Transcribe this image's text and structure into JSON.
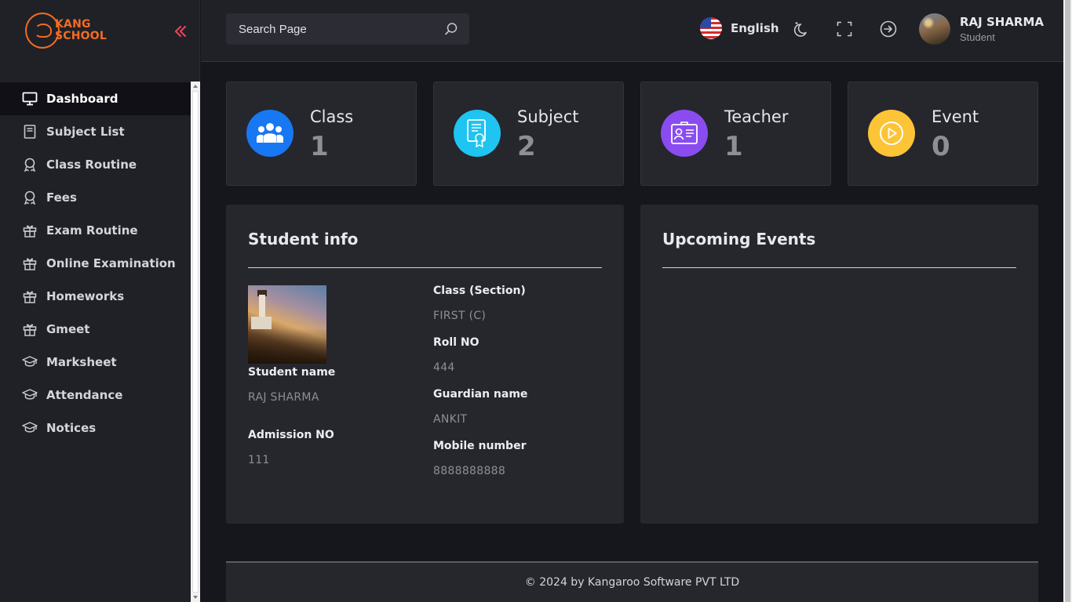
{
  "brand": {
    "line1": "KANG",
    "line2": "SCHOOL",
    "accent": "#f26d21"
  },
  "sidebar": {
    "items": [
      {
        "label": "Dashboard",
        "icon": "monitor-icon",
        "active": true
      },
      {
        "label": "Subject List",
        "icon": "book-icon"
      },
      {
        "label": "Class Routine",
        "icon": "award-icon"
      },
      {
        "label": "Fees",
        "icon": "award-icon"
      },
      {
        "label": "Exam Routine",
        "icon": "gift-icon"
      },
      {
        "label": "Online Examination",
        "icon": "gift-icon"
      },
      {
        "label": "Homeworks",
        "icon": "gift-icon"
      },
      {
        "label": "Gmeet",
        "icon": "gift-icon"
      },
      {
        "label": "Marksheet",
        "icon": "graduation-cap-icon"
      },
      {
        "label": "Attendance",
        "icon": "graduation-cap-icon"
      },
      {
        "label": "Notices",
        "icon": "graduation-cap-icon"
      }
    ]
  },
  "header": {
    "search_placeholder": "Search Page",
    "language": "English",
    "user": {
      "name": "RAJ SHARMA",
      "role": "Student"
    }
  },
  "stats": [
    {
      "label": "Class",
      "value": "1",
      "color": "#1877f2",
      "icon": "users-icon"
    },
    {
      "label": "Subject",
      "value": "2",
      "color": "#1fc4f0",
      "icon": "certificate-icon"
    },
    {
      "label": "Teacher",
      "value": "1",
      "color": "#8a4cf0",
      "icon": "id-card-icon"
    },
    {
      "label": "Event",
      "value": "0",
      "color": "#fcc436",
      "icon": "play-icon"
    }
  ],
  "student_info": {
    "title": "Student info",
    "fields": {
      "student_name_label": "Student name",
      "student_name": "RAJ SHARMA",
      "admission_label": "Admission NO",
      "admission": "111",
      "class_label": "Class (Section)",
      "class": "FIRST (C)",
      "roll_label": "Roll NO",
      "roll": "444",
      "guardian_label": "Guardian name",
      "guardian": "ANKIT",
      "mobile_label": "Mobile number",
      "mobile": "8888888888"
    }
  },
  "events": {
    "title": "Upcoming Events"
  },
  "footer": {
    "text": "© 2024 by Kangaroo Software PVT LTD"
  }
}
